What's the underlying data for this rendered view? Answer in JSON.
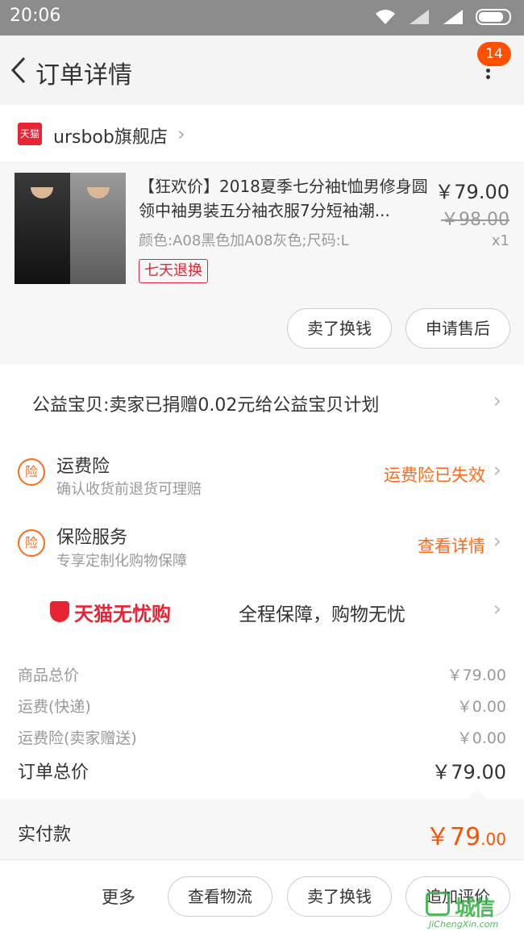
{
  "status_bar": {
    "time": "20:06"
  },
  "header": {
    "title": "订单详情",
    "badge_count": "14"
  },
  "shop": {
    "logo_text": "天猫",
    "name": "ursbob旗舰店"
  },
  "product": {
    "name": "【狂欢价】2018夏季七分袖t恤男修身圆领中袖男装五分袖衣服7分短袖潮...",
    "spec": "颜色:A08黑色加A08灰色;尺码:L",
    "tag": "七天退换",
    "price": "￥79.00",
    "original_price": "￥98.00",
    "quantity": "x1",
    "buttons": {
      "sell": "卖了换钱",
      "after_sale": "申请售后"
    }
  },
  "charity": {
    "text": "公益宝贝:卖家已捐赠0.02元给公益宝贝计划"
  },
  "insurance": [
    {
      "icon": "险",
      "title": "运费险",
      "subtitle": "确认收货前退货可理赔",
      "status": "运费险已失效"
    },
    {
      "icon": "险",
      "title": "保险服务",
      "subtitle": "专享定制化购物保障",
      "status": "查看详情"
    }
  ],
  "wuyou": {
    "logo_text": "天猫无忧购",
    "text": "全程保障，购物无忧"
  },
  "summary": [
    {
      "label": "商品总价",
      "value": "￥79.00"
    },
    {
      "label": "运费(快递)",
      "value": "￥0.00"
    },
    {
      "label": "运费险(卖家赠送)",
      "value": "￥0.00"
    }
  ],
  "order_total": {
    "label": "订单总价",
    "value": "￥79.00"
  },
  "paid": {
    "label": "实付款",
    "value_main": "￥79",
    "value_decimal": ".00"
  },
  "bottom_bar": {
    "more": "更多",
    "logistics": "查看物流",
    "sell": "卖了换钱",
    "review": "追加评价"
  },
  "watermark": {
    "text": "城信",
    "url": "JiChengXin.com"
  },
  "colors": {
    "accent": "#ff5000",
    "tmall_red": "#e62434",
    "orange": "#ff6a1a"
  }
}
